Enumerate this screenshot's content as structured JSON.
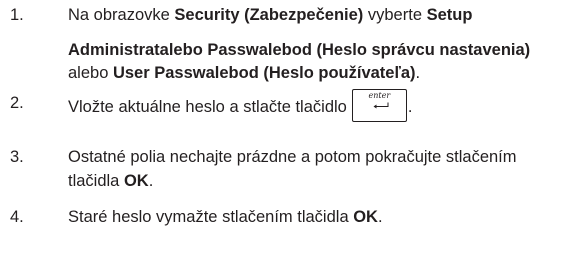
{
  "steps": [
    {
      "number": "1.",
      "line1_a": "Na obrazovke ",
      "line1_b": "Security (Zabezpečenie)",
      "line1_c": " vyberte ",
      "line1_d": "Setup",
      "line2": "Administratalebo Passwalebod (Heslo správcu nastavenia)",
      "line3_a": "alebo ",
      "line3_b": "User Passwalebod (Heslo používateľa)",
      "line3_c": "."
    },
    {
      "number": "2.",
      "text": "Vložte aktuálne heslo a stlačte tlačidlo",
      "key_label": "enter",
      "after": "."
    },
    {
      "number": "3.",
      "line1": "Ostatné polia nechajte prázdne a potom pokračujte stlačením",
      "line2_a": "tlačidla ",
      "line2_b": "OK",
      "line2_c": "."
    },
    {
      "number": "4.",
      "text_a": "Staré heslo vymažte stlačením tlačidla ",
      "text_b": "OK",
      "text_c": "."
    }
  ],
  "icons": {
    "enter_key": "enter-key-icon"
  }
}
